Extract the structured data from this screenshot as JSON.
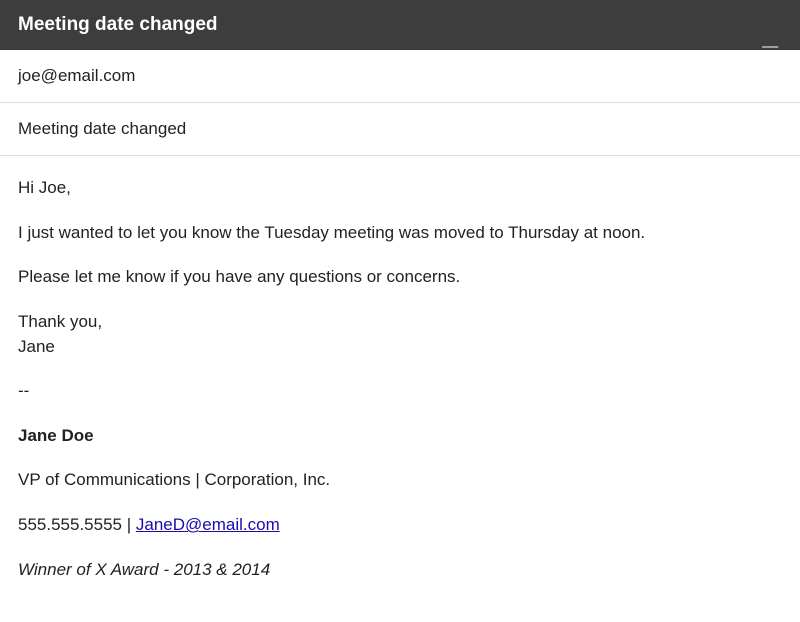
{
  "header": {
    "title": "Meeting date changed"
  },
  "fields": {
    "to": "joe@email.com",
    "subject": "Meeting date changed"
  },
  "body": {
    "greeting": "Hi Joe,",
    "line1": "I just wanted to let you know the Tuesday meeting was moved to Thursday at noon.",
    "line2": "Please let me know if you have any questions or concerns.",
    "closing1": "Thank you,",
    "closing2": "Jane"
  },
  "signature": {
    "separator": "--",
    "name": "Jane Doe",
    "title": "VP of Communications | Corporation, Inc.",
    "phone": "555.555.5555",
    "divider": " | ",
    "email": "JaneD@email.com",
    "award": "Winner of X Award - 2013 & 2014"
  }
}
